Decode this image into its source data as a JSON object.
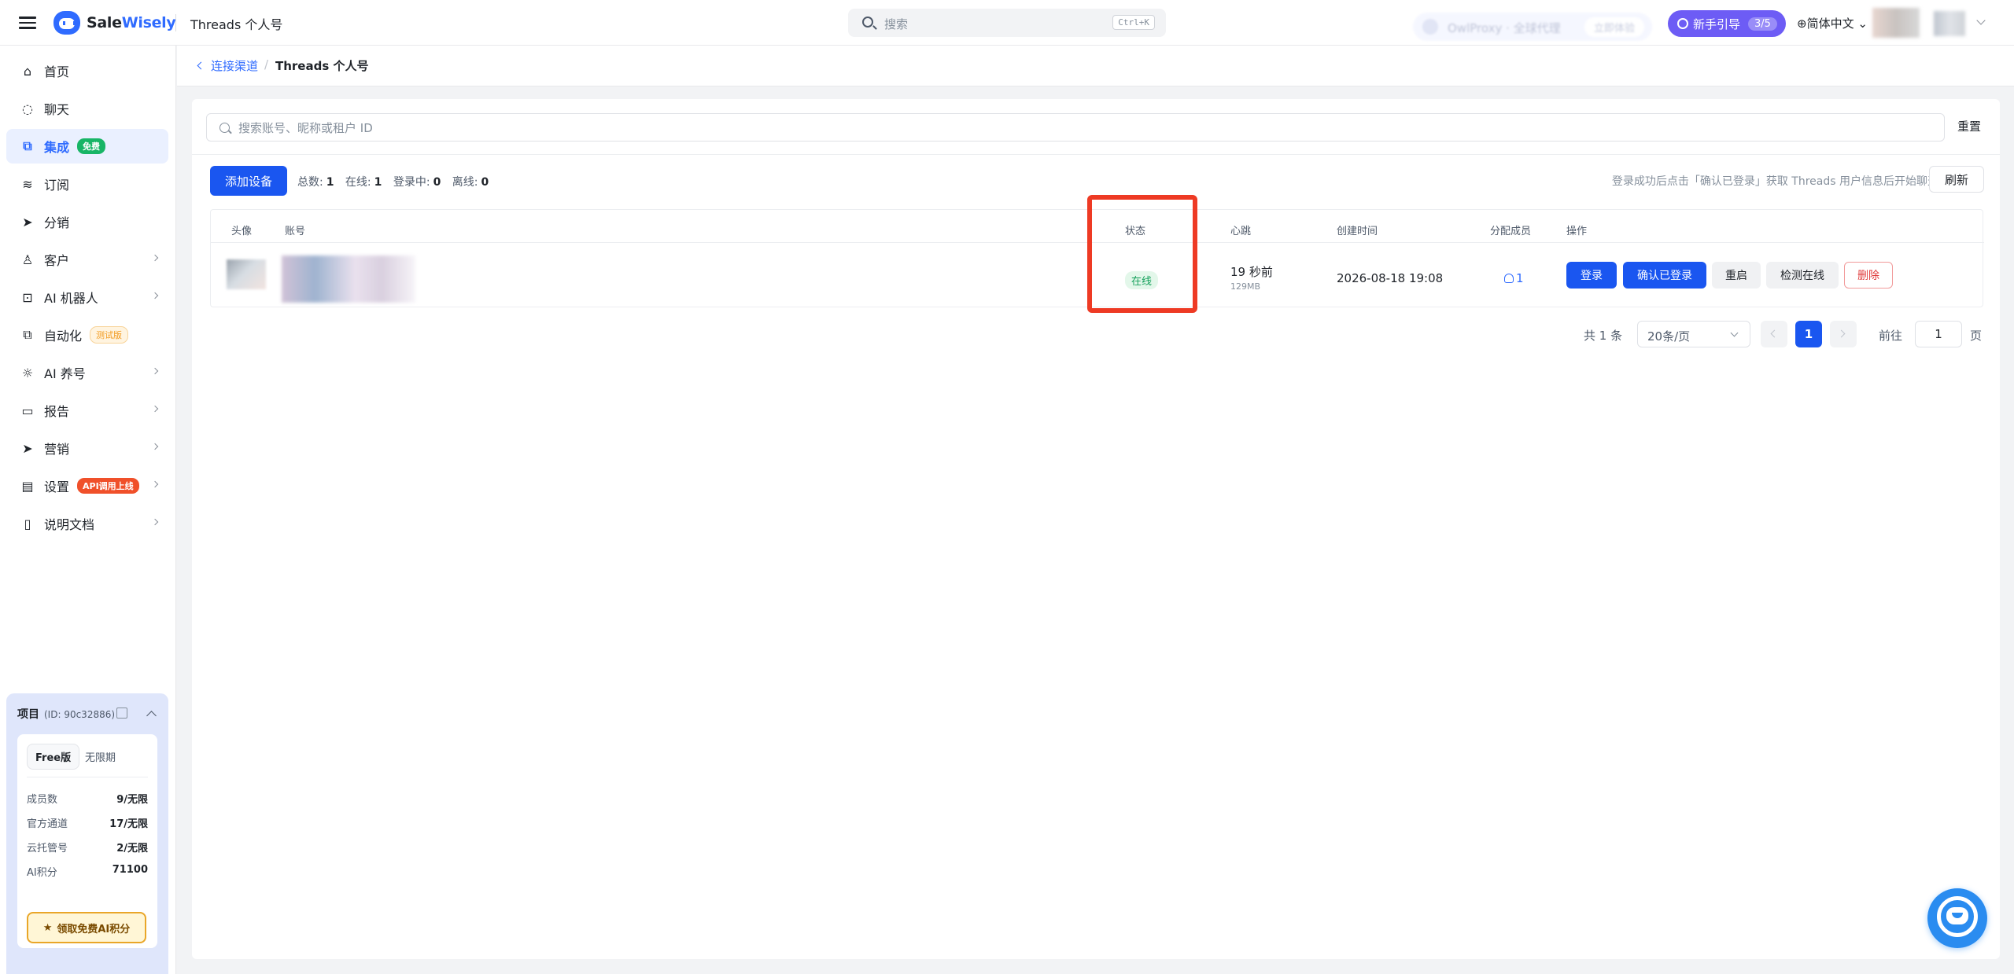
{
  "app": {
    "brand_a": "Sale",
    "brand_b": "Wisely",
    "page_title": "Threads 个人号"
  },
  "search": {
    "placeholder": "搜索",
    "shortcut": "Ctrl+K"
  },
  "promo": {
    "label": "OwlProxy · 全球代理",
    "button": "立即体验"
  },
  "guide": {
    "label": "新手引导",
    "progress": "3/5"
  },
  "language": "简体中文",
  "sidebar": {
    "items": [
      {
        "label": "首页",
        "icon": "home-icon"
      },
      {
        "label": "聊天",
        "icon": "chat-icon"
      },
      {
        "label": "集成",
        "icon": "integration-icon",
        "tag": "免费",
        "active": true
      },
      {
        "label": "订阅",
        "icon": "database-icon"
      },
      {
        "label": "分销",
        "icon": "send-icon"
      },
      {
        "label": "客户",
        "icon": "user-icon"
      },
      {
        "label": "AI 机器人",
        "icon": "chip-icon"
      },
      {
        "label": "自动化",
        "icon": "automation-icon",
        "tag": "测试版"
      },
      {
        "label": "AI 养号",
        "icon": "sun-icon"
      },
      {
        "label": "报告",
        "icon": "report-icon"
      },
      {
        "label": "营销",
        "icon": "send-icon"
      },
      {
        "label": "设置",
        "icon": "settings-icon",
        "tag": "API调用上线"
      },
      {
        "label": "说明文档",
        "icon": "doc-icon"
      }
    ]
  },
  "project": {
    "title": "项目",
    "id": "(ID: 90c32886)",
    "plan": "Free版",
    "expiry": "无限期",
    "stats": [
      {
        "label": "成员数",
        "value": "9/无限"
      },
      {
        "label": "官方通道",
        "value": "17/无限"
      },
      {
        "label": "云托管号",
        "value": "2/无限"
      },
      {
        "label": "AI积分",
        "value": "71100"
      }
    ],
    "claim_button": "领取免费AI积分"
  },
  "breadcrumb": {
    "parent": "连接渠道",
    "separator": "/",
    "current": "Threads 个人号"
  },
  "filter": {
    "placeholder": "搜索账号、昵称或租户 ID",
    "reset": "重置"
  },
  "toolbar": {
    "add_button": "添加设备",
    "summary": [
      {
        "label": "总数:",
        "value": "1"
      },
      {
        "label": "在线:",
        "value": "1"
      },
      {
        "label": "登录中:",
        "value": "0"
      },
      {
        "label": "离线:",
        "value": "0"
      }
    ],
    "hint": "登录成功后点击「确认已登录」获取 Threads 用户信息后开始聊天",
    "refresh": "刷新"
  },
  "table": {
    "headers": {
      "avatar": "头像",
      "account": "账号",
      "status": "状态",
      "heartbeat": "心跳",
      "created": "创建时间",
      "members": "分配成员",
      "actions": "操作"
    },
    "rows": [
      {
        "status": "在线",
        "heartbeat": "19 秒前",
        "memory": "129MB",
        "created": "2026-08-18 19:08",
        "members": "1",
        "actions": [
          "登录",
          "确认已登录",
          "重启",
          "检测在线",
          "删除"
        ]
      }
    ]
  },
  "pagination": {
    "total": "共 1 条",
    "page_size": "20条/页",
    "current": "1",
    "goto_label": "前往",
    "goto_value": "1",
    "unit": "页"
  },
  "colors": {
    "accent": "#1a56f0",
    "online": "#15a05b",
    "highlight": "#ee3a24",
    "danger": "#e03b3b"
  }
}
